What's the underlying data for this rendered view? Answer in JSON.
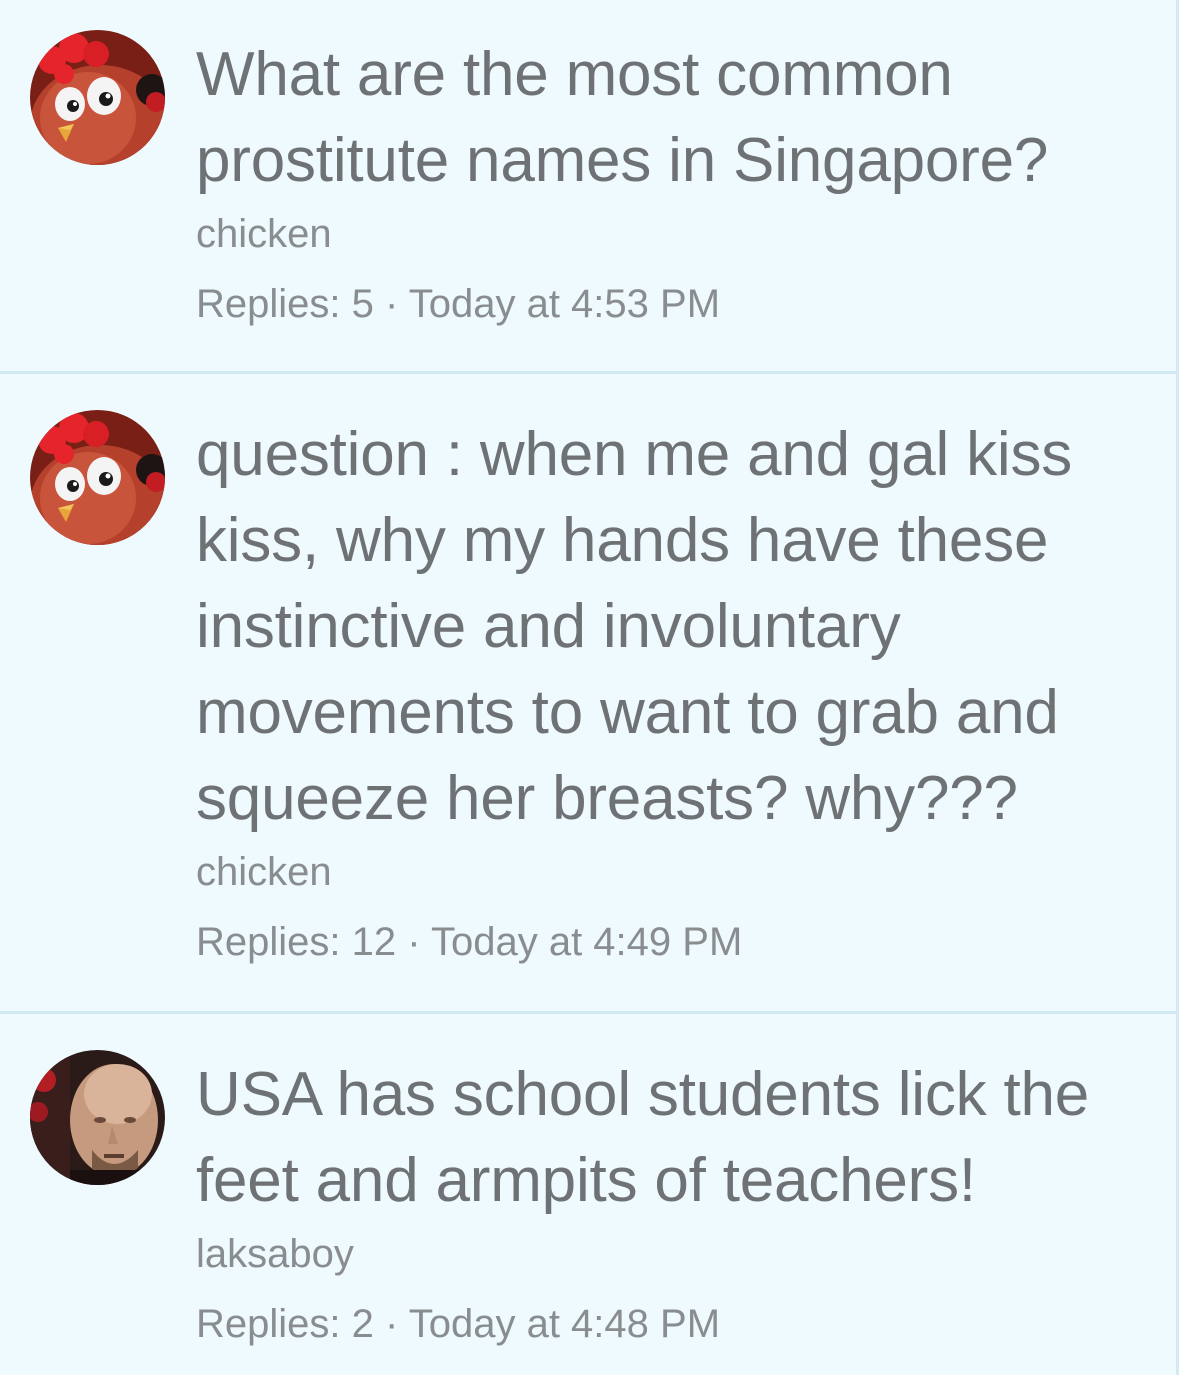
{
  "threads": [
    {
      "title": "What are the most common prostitute names in Singapore?",
      "author": "chicken",
      "replies_label": "Replies:",
      "replies": "5",
      "separator": "·",
      "time": "Today at 4:53 PM",
      "avatar_icon": "chicken-avatar-icon"
    },
    {
      "title": "question : when me and gal kiss kiss, why my hands have these instinctive and involuntary movements to want to grab and squeeze her breasts? why???",
      "author": "chicken",
      "replies_label": "Replies:",
      "replies": "12",
      "separator": "·",
      "time": "Today at 4:49 PM",
      "avatar_icon": "chicken-avatar-icon"
    },
    {
      "title": "USA has school students lick the feet and armpits of teachers!",
      "author": "laksaboy",
      "replies_label": "Replies:",
      "replies": "2",
      "separator": "·",
      "time": "Today at 4:48 PM",
      "avatar_icon": "bald-man-avatar-icon"
    }
  ],
  "colors": {
    "background": "#eefafd",
    "divider": "#cfe8f2",
    "title_text": "#6f7274",
    "meta_text": "#8a8d8f"
  }
}
